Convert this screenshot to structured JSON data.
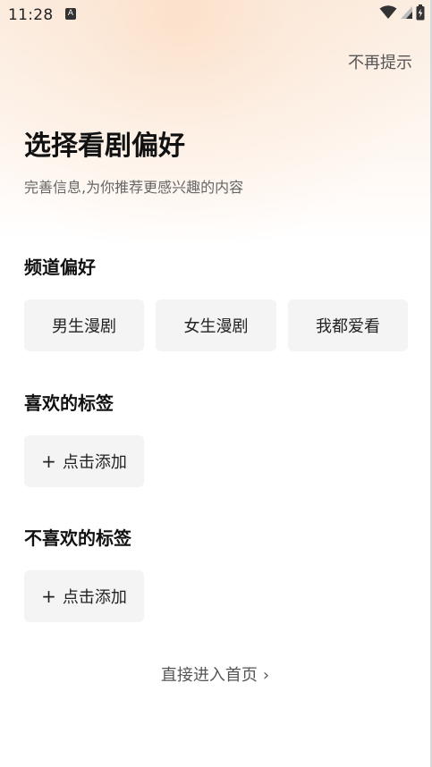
{
  "status_bar": {
    "time": "11:28",
    "notification_icon": "text-a-icon",
    "icons": [
      "wifi-icon",
      "cell-signal-icon",
      "battery-charging-icon"
    ]
  },
  "header": {
    "skip_label": "不再提示"
  },
  "intro": {
    "title": "选择看剧偏好",
    "subtitle": "完善信息,为你推荐更感兴趣的内容"
  },
  "channel": {
    "label": "频道偏好",
    "options": [
      "男生漫剧",
      "女生漫剧",
      "我都爱看"
    ]
  },
  "liked_tags": {
    "label": "喜欢的标签",
    "add_label": "点击添加"
  },
  "disliked_tags": {
    "label": "不喜欢的标签",
    "add_label": "点击添加"
  },
  "footer": {
    "enter_label": "直接进入首页"
  },
  "colors": {
    "chip_bg": "#f4f4f4",
    "title": "#111111",
    "secondary_text": "#666666",
    "header_gradient": "#fbeee2"
  }
}
